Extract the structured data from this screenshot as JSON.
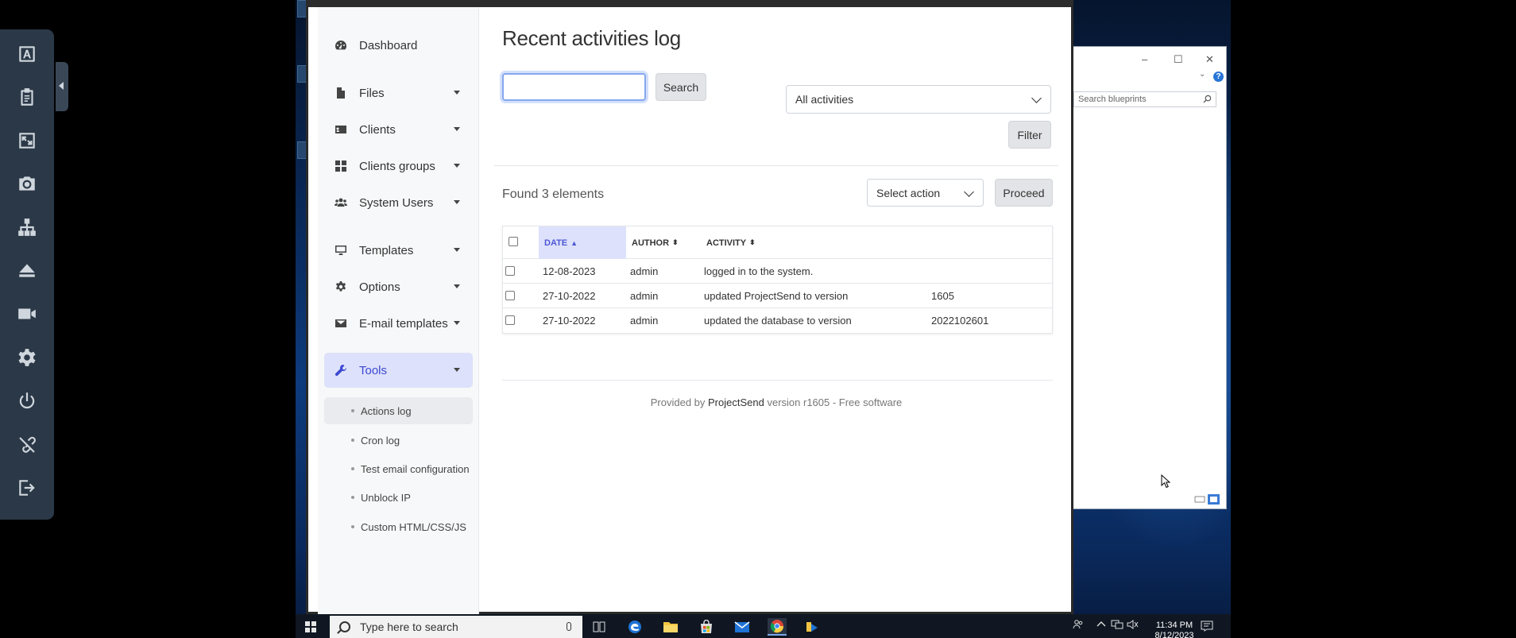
{
  "remote_toolbar": {
    "buttons": [
      "keyboard-icon",
      "clipboard-icon",
      "fullscreen-icon",
      "camera-icon",
      "network-icon",
      "eject-icon",
      "video-icon",
      "settings-icon",
      "power-icon",
      "disconnect-icon",
      "logout-icon"
    ]
  },
  "explorer": {
    "search_placeholder": "Search blueprints"
  },
  "sidebar": {
    "items": [
      {
        "label": "Dashboard",
        "icon": "dashboard-icon"
      },
      {
        "label": "Files",
        "icon": "file-icon"
      },
      {
        "label": "Clients",
        "icon": "id-card-icon"
      },
      {
        "label": "Clients groups",
        "icon": "grid-icon"
      },
      {
        "label": "System Users",
        "icon": "users-icon"
      },
      {
        "label": "Templates",
        "icon": "monitor-icon"
      },
      {
        "label": "Options",
        "icon": "gear-icon"
      },
      {
        "label": "E-mail templates",
        "icon": "envelope-icon"
      },
      {
        "label": "Tools",
        "icon": "wrench-icon"
      }
    ],
    "tools_sub": [
      "Actions log",
      "Cron log",
      "Test email configuration",
      "Unblock IP",
      "Custom HTML/CSS/JS"
    ]
  },
  "main": {
    "title": "Recent activities log",
    "search_value": "",
    "search_button": "Search",
    "activity_filter": "All activities",
    "filter_button": "Filter",
    "found_text": "Found 3 elements",
    "action_select": "Select action",
    "proceed_button": "Proceed",
    "columns": [
      "DATE",
      "AUTHOR",
      "ACTIVITY"
    ],
    "rows": [
      {
        "date": "12-08-2023",
        "author": "admin",
        "activity": "logged in to the system.",
        "extra": ""
      },
      {
        "date": "27-10-2022",
        "author": "admin",
        "activity": "updated ProjectSend to version",
        "extra": "1605"
      },
      {
        "date": "27-10-2022",
        "author": "admin",
        "activity": "updated the database to version",
        "extra": "2022102601"
      }
    ],
    "footer": {
      "prefix": "Provided by",
      "brand": "ProjectSend",
      "suffix": "version r1605 - Free software"
    }
  },
  "taskbar": {
    "search_placeholder": "Type here to search",
    "time": "11:34 PM",
    "date": "8/12/2023"
  },
  "colors": {
    "accent": "#3c48d0",
    "accent_bg": "#dde1fb",
    "toolbar": "#2b3847"
  }
}
